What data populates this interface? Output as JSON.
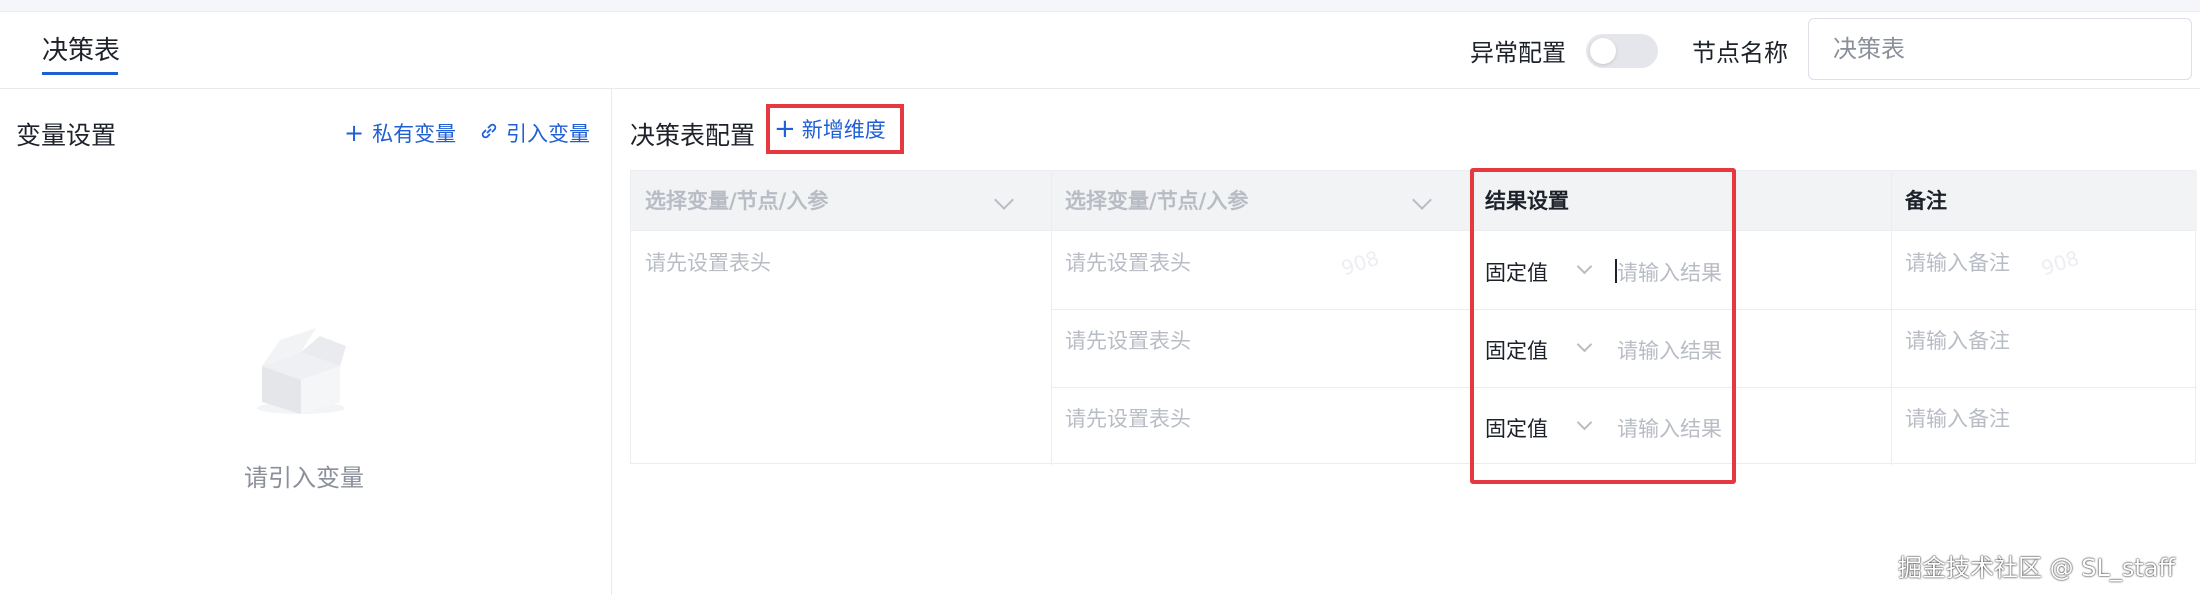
{
  "header": {
    "tab_label": "决策表",
    "exception_label": "异常配置",
    "exception_enabled": false,
    "node_name_label": "节点名称",
    "node_name_value": "决策表"
  },
  "left_panel": {
    "title": "变量设置",
    "private_var_label": "私有变量",
    "import_var_label": "引入变量",
    "empty_text": "请引入变量"
  },
  "decision_table": {
    "title": "决策表配置",
    "add_dimension_label": "新增维度",
    "columns": [
      "选择变量/节点/入参",
      "选择变量/节点/入参",
      "结果设置",
      "备注"
    ],
    "col1_cell": "请先设置表头",
    "rows": [
      {
        "col2": "请先设置表头",
        "result_type": "固定值",
        "result_placeholder": "请输入结果",
        "remark_placeholder": "请输入备注"
      },
      {
        "col2": "请先设置表头",
        "result_type": "固定值",
        "result_placeholder": "请输入结果",
        "remark_placeholder": "请输入备注"
      },
      {
        "col2": "请先设置表头",
        "result_type": "固定值",
        "result_placeholder": "请输入结果",
        "remark_placeholder": "请输入备注"
      }
    ],
    "cell_watermark": "908"
  },
  "watermark": "掘金技术社区 @ SL_staff",
  "colors": {
    "accent": "#1f5fd6",
    "highlight_border": "#e6393f",
    "header_bg": "#f2f3f5",
    "placeholder": "#b8bcc4"
  },
  "icons": {
    "plus": "plus-icon",
    "link": "link-icon",
    "chevron": "chevron-down-icon",
    "empty": "empty-box-icon"
  }
}
